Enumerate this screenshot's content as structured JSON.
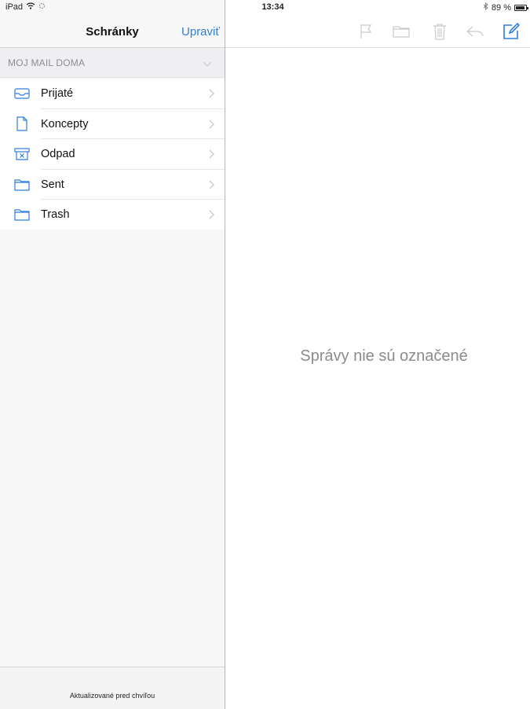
{
  "status_bar": {
    "device": "iPad",
    "time": "13:34",
    "battery": "89 %",
    "battery_level": 0.89
  },
  "master": {
    "title": "Schránky",
    "edit_label": "Upraviť",
    "account_label": "MOJ MAIL DOMA",
    "mailboxes": [
      {
        "label": "Prijaté",
        "icon": "inbox-icon"
      },
      {
        "label": "Koncepty",
        "icon": "document-icon"
      },
      {
        "label": "Odpad",
        "icon": "junk-icon"
      },
      {
        "label": "Sent",
        "icon": "folder-icon"
      },
      {
        "label": "Trash",
        "icon": "folder-icon"
      }
    ],
    "footer_text": "Aktualizované pred chvíľou"
  },
  "detail": {
    "empty_message": "Správy nie sú označené",
    "toolbar": [
      "flag-icon",
      "folder-move-icon",
      "trash-icon",
      "reply-icon",
      "compose-icon"
    ]
  },
  "colors": {
    "accent": "#2f7ddf",
    "disabled_icon": "#c9c9cf",
    "section_bg": "#efeff3"
  }
}
